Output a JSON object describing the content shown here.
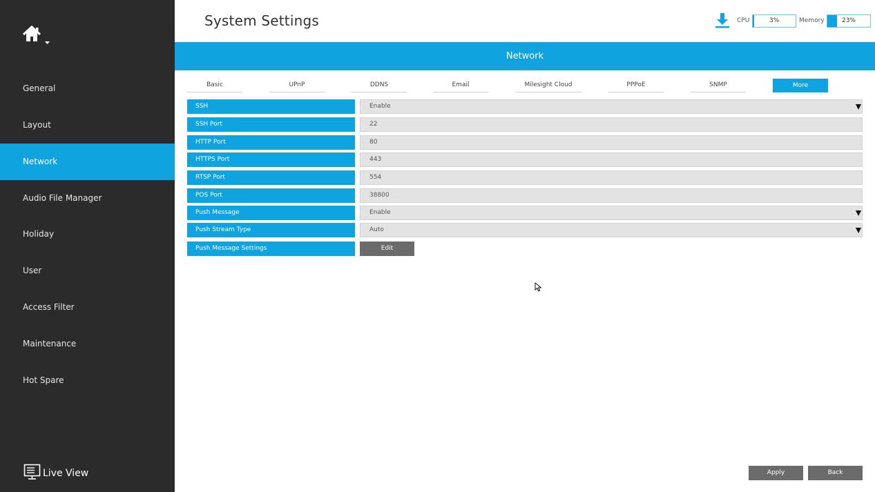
{
  "sidebar": {
    "home_icon": "home-icon",
    "items": [
      {
        "label": "General",
        "active": false
      },
      {
        "label": "Layout",
        "active": false
      },
      {
        "label": "Network",
        "active": true
      },
      {
        "label": "Audio File Manager",
        "active": false
      },
      {
        "label": "Holiday",
        "active": false
      },
      {
        "label": "User",
        "active": false
      },
      {
        "label": "Access Filter",
        "active": false
      },
      {
        "label": "Maintenance",
        "active": false
      },
      {
        "label": "Hot Spare",
        "active": false
      }
    ],
    "live_view_label": "Live View"
  },
  "header": {
    "title": "System Settings",
    "cpu_label": "CPU",
    "cpu_value": "3%",
    "cpu_percent": 3,
    "memory_label": "Memory",
    "memory_value": "23%",
    "memory_percent": 23
  },
  "banner": {
    "title": "Network"
  },
  "tabs": [
    {
      "label": "Basic",
      "active": false
    },
    {
      "label": "UPnP",
      "active": false
    },
    {
      "label": "DDNS",
      "active": false
    },
    {
      "label": "Email",
      "active": false
    },
    {
      "label": "Milesight Cloud",
      "active": false
    },
    {
      "label": "PPPoE",
      "active": false
    },
    {
      "label": "SNMP",
      "active": false
    },
    {
      "label": "More",
      "active": true
    }
  ],
  "rows": [
    {
      "label": "SSH",
      "value": "Enable",
      "type": "select"
    },
    {
      "label": "SSH Port",
      "value": "22",
      "type": "input"
    },
    {
      "label": "HTTP Port",
      "value": "80",
      "type": "input"
    },
    {
      "label": "HTTPS Port",
      "value": "443",
      "type": "input"
    },
    {
      "label": "RTSP Port",
      "value": "554",
      "type": "input"
    },
    {
      "label": "POS Port",
      "value": "38800",
      "type": "input"
    },
    {
      "label": "Push Message",
      "value": "Enable",
      "type": "select"
    },
    {
      "label": "Push Stream Type",
      "value": "Auto",
      "type": "select"
    },
    {
      "label": "Push Message Settings",
      "value": "Edit",
      "type": "button"
    }
  ],
  "footer": {
    "apply_label": "Apply",
    "back_label": "Back"
  },
  "colors": {
    "accent": "#0fa4e0",
    "sidebar": "#2b2b2b",
    "button": "#6b6b6b"
  }
}
